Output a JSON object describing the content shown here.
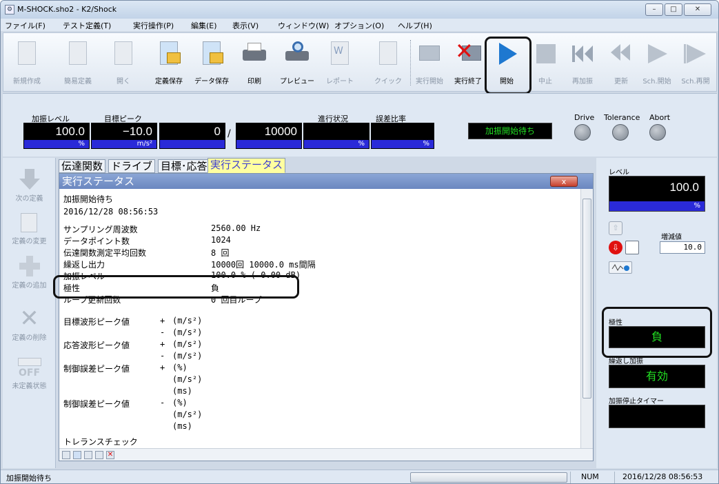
{
  "window": {
    "title": "M-SHOCK.sho2 - K2/Shock",
    "min": "–",
    "max": "□",
    "close": "✕"
  },
  "menu": [
    "ファイル(F)",
    "テスト定義(T)",
    "実行操作(P)",
    "編集(E)",
    "表示(V)",
    "ウィンドウ(W)",
    "オプション(O)",
    "ヘルプ(H)"
  ],
  "toolbar": [
    {
      "label": "新規作成",
      "icon": "new-doc-icon",
      "enabled": false
    },
    {
      "label": "簡易定義",
      "icon": "simple-def-icon",
      "enabled": false
    },
    {
      "label": "開く",
      "icon": "open-icon",
      "enabled": false
    },
    {
      "label": "定義保存",
      "icon": "save-def-icon",
      "enabled": true
    },
    {
      "label": "データ保存",
      "icon": "save-data-icon",
      "enabled": true
    },
    {
      "label": "印刷",
      "icon": "print-icon",
      "enabled": true
    },
    {
      "label": "プレビュー",
      "icon": "preview-icon",
      "enabled": true
    },
    {
      "label": "レポート",
      "icon": "report-icon",
      "enabled": false
    },
    {
      "label": "クイック",
      "icon": "quick-icon",
      "enabled": false
    },
    {
      "label": "実行開始",
      "icon": "run-start-icon",
      "enabled": false
    },
    {
      "label": "実行終了",
      "icon": "run-end-icon",
      "enabled": true
    },
    {
      "label": "開始",
      "icon": "play-icon",
      "enabled": true
    },
    {
      "label": "中止",
      "icon": "stop-icon",
      "enabled": false
    },
    {
      "label": "再加振",
      "icon": "rewind-icon",
      "enabled": false
    },
    {
      "label": "更新",
      "icon": "update-icon",
      "enabled": false
    },
    {
      "label": "Sch.開始",
      "icon": "sch-start-icon",
      "enabled": false
    },
    {
      "label": "Sch.再開",
      "icon": "sch-resume-icon",
      "enabled": false
    }
  ],
  "panel": {
    "level_label": "加振レベル",
    "level_value": "100.0",
    "level_unit": "%",
    "target_label": "目標ピーク",
    "target_value": "−10.0",
    "target_unit": "m/s²",
    "progress_label": "進行状況",
    "progress_value": "0",
    "progress_sep": "/",
    "progress_total": "10000",
    "progress_unit": "%",
    "error_label": "誤差比率",
    "error_unit": "%",
    "status": "加振開始待ち",
    "lamps": [
      "Drive",
      "Tolerance",
      "Abort"
    ]
  },
  "leftbar": [
    "次の定義",
    "定義の変更",
    "定義の追加",
    "定義の削除",
    "未定義状態"
  ],
  "tabs": [
    "伝達関数",
    "ドライブ",
    "目標･応答",
    "実行ステータス"
  ],
  "status_window": {
    "title": "実行ステータス",
    "close": "x",
    "lines": [
      {
        "label": "加振開始待ち",
        "value": ""
      },
      {
        "label": "2016/12/28 08:56:53",
        "value": ""
      },
      {
        "label": "サンプリング周波数",
        "value": "2560.00 Hz"
      },
      {
        "label": "データポイント数",
        "value": "1024"
      },
      {
        "label": "伝達関数測定平均回数",
        "value": "8 回"
      },
      {
        "label": "繰返し出力",
        "value": "10000回 10000.0 ms間隔"
      },
      {
        "label": "加振レベル",
        "value": "100.0 % ( 0.00 dB)"
      },
      {
        "label": "極性",
        "value": "負"
      },
      {
        "label": "ループ更新回数",
        "value": "0 回目ループ"
      }
    ],
    "peaks": [
      {
        "label": "目標波形ピーク値",
        "sign1": "+",
        "u1": "(m/s²)",
        "sign2": "-",
        "u2": "(m/s²)"
      },
      {
        "label": "応答波形ピーク値",
        "sign1": "+",
        "u1": "(m/s²)",
        "sign2": "-",
        "u2": "(m/s²)"
      },
      {
        "label": "制御誤差ピーク値",
        "sign1": "+",
        "u1": "(%)",
        "u2": "(m/s²)",
        "u3": "(ms)"
      },
      {
        "label": "制御誤差ピーク値",
        "sign1": "-",
        "u1": "(%)",
        "u2": "(m/s²)",
        "u3": "(ms)"
      }
    ],
    "tolerance": "トレランスチェック"
  },
  "right": {
    "level_label": "レベル",
    "level_value": "100.0",
    "level_unit": "%",
    "step_label": "増減値",
    "step_value": "10.0",
    "polarity_label": "極性",
    "polarity_value": "負",
    "repeat_label": "繰返し加振",
    "repeat_value": "有効",
    "timer_label": "加振停止タイマー"
  },
  "statusbar": {
    "left": "加振開始待ち",
    "num": "NUM",
    "datetime": "2016/12/28 08:56:53"
  },
  "colors": {
    "display_bg": "#000000",
    "display_green": "#22e022",
    "unit_bar": "#2a2ad8",
    "active_tab": "#ffffa0",
    "play_blue": "#1e78d0",
    "stop_red": "#e01010"
  }
}
